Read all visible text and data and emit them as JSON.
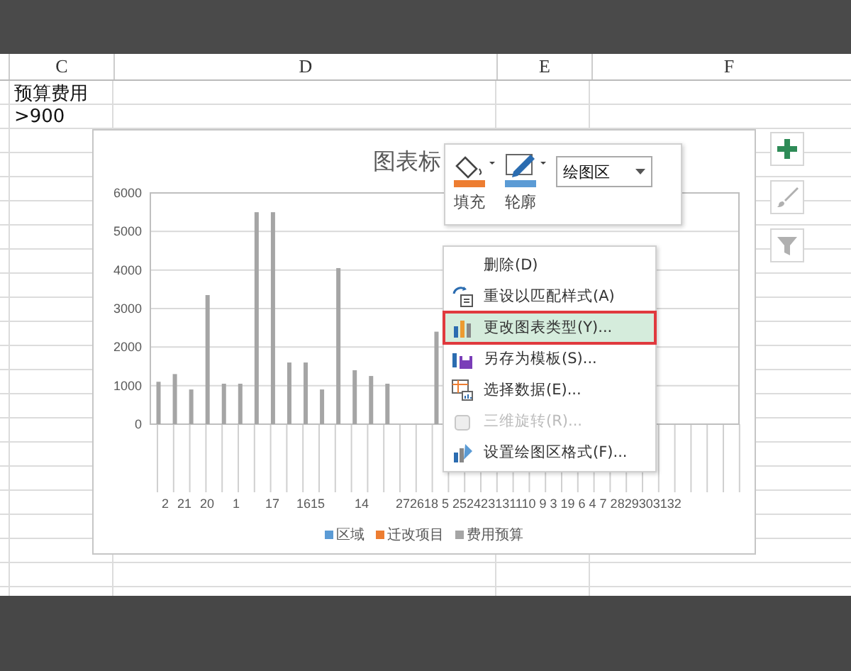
{
  "columns": [
    {
      "label": "C"
    },
    {
      "label": "D"
    },
    {
      "label": "E"
    },
    {
      "label": "F"
    }
  ],
  "cells": [
    {
      "text": "预算费用"
    },
    {
      "text": ">900"
    }
  ],
  "chart": {
    "title": "图表标",
    "chart_data": {
      "type": "bar",
      "grid": true,
      "series": [
        {
          "name": "区域",
          "color": "#5b9bd5",
          "values": [
            null,
            null,
            null,
            null,
            null,
            null,
            null,
            null,
            null,
            null,
            null,
            null,
            null,
            null,
            null,
            null,
            null,
            null,
            null,
            null,
            null,
            null,
            null,
            null,
            null,
            null,
            null,
            null,
            null,
            null,
            null,
            null,
            null,
            null,
            null,
            null
          ]
        },
        {
          "name": "迁改项目",
          "color": "#ed7d31",
          "values": [
            null,
            null,
            null,
            null,
            null,
            null,
            null,
            null,
            null,
            null,
            null,
            null,
            null,
            null,
            null,
            null,
            null,
            null,
            null,
            null,
            null,
            null,
            null,
            null,
            null,
            null,
            null,
            null,
            null,
            null,
            null,
            null,
            null,
            null,
            null,
            null
          ]
        },
        {
          "name": "费用预算",
          "color": "#a5a5a5",
          "values": [
            1100,
            1300,
            900,
            3350,
            1050,
            1050,
            5500,
            5500,
            1600,
            1600,
            900,
            4050,
            1400,
            1250,
            1050,
            null,
            null,
            2400,
            null,
            null,
            null,
            null,
            null,
            null,
            null,
            null,
            null,
            null,
            null,
            null,
            null,
            null,
            null,
            null,
            null,
            null
          ]
        }
      ],
      "ylim": [
        0,
        6000
      ],
      "yticks": [
        0,
        1000,
        2000,
        3000,
        4000,
        5000,
        6000
      ]
    },
    "x_labels": [
      "2",
      "21",
      "20",
      "1",
      "17",
      "1615",
      "14",
      "272618 5 252423131110 9 3 19 6 4 7 2829303132"
    ]
  },
  "side_buttons": [
    {
      "kind": "add"
    },
    {
      "kind": "style"
    },
    {
      "kind": "filter"
    }
  ],
  "format_popup": {
    "buttons": [
      {
        "label": "填充",
        "kind": "fill"
      },
      {
        "label": "轮廓",
        "kind": "outline"
      }
    ],
    "dropdown": "绘图区"
  },
  "context_menu": [
    {
      "label": "删除(D)",
      "kind": "none",
      "selected": false,
      "disabled": false
    },
    {
      "label": "重设以匹配样式(A)",
      "kind": "reset",
      "selected": false,
      "disabled": false
    },
    {
      "label": "更改图表类型(Y)...",
      "kind": "chart",
      "selected": true,
      "disabled": false
    },
    {
      "label": "另存为模板(S)...",
      "kind": "template",
      "selected": false,
      "disabled": false
    },
    {
      "label": "选择数据(E)...",
      "kind": "data",
      "selected": false,
      "disabled": false
    },
    {
      "label": "三维旋转(R)...",
      "kind": "rotate",
      "selected": false,
      "disabled": true
    },
    {
      "label": "设置绘图区格式(F)...",
      "kind": "format",
      "selected": false,
      "disabled": false
    }
  ]
}
